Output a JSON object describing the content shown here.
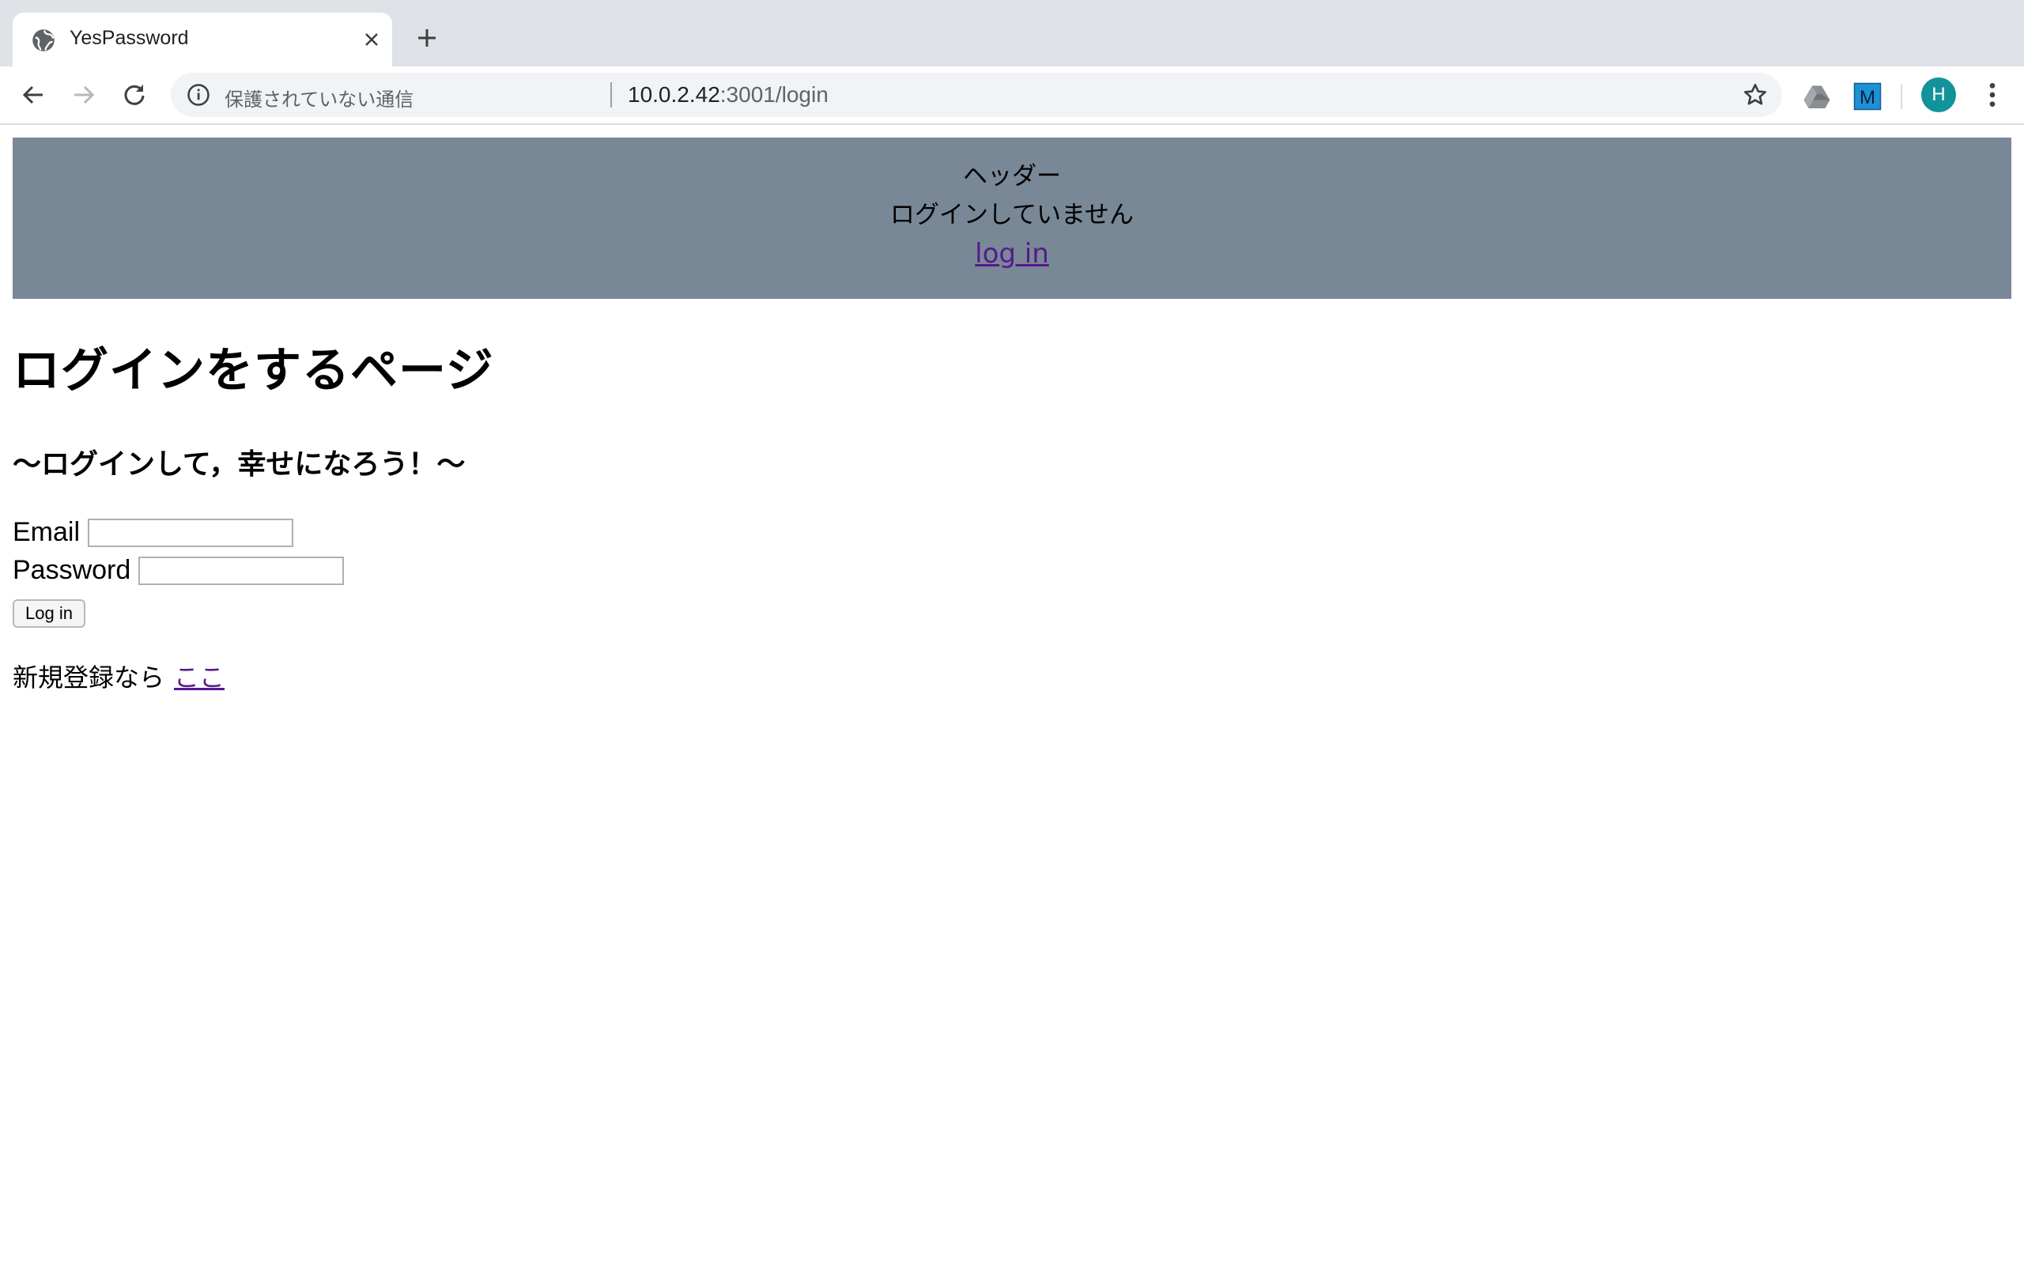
{
  "browser": {
    "tab_title": "YesPassword",
    "security_label": "保護されていない通信",
    "url_host": "10.0.2.42",
    "url_rest": ":3001/login",
    "profile_initial": "H",
    "extensions": [
      "google-drive-icon",
      "m-extension-icon"
    ]
  },
  "header": {
    "title": "ヘッダー",
    "status": "ログインしていません",
    "login_link": "log in"
  },
  "main": {
    "title": "ログインをするページ",
    "subtitle": "〜ログインして，幸せになろう！〜"
  },
  "form": {
    "email_label": "Email",
    "email_value": "",
    "password_label": "Password",
    "password_value": "",
    "submit_label": "Log in"
  },
  "register": {
    "prefix": "新規登録なら",
    "link": "ここ"
  },
  "colors": {
    "header_bg": "#798897",
    "link": "#551a8b",
    "avatar": "#12939a"
  }
}
